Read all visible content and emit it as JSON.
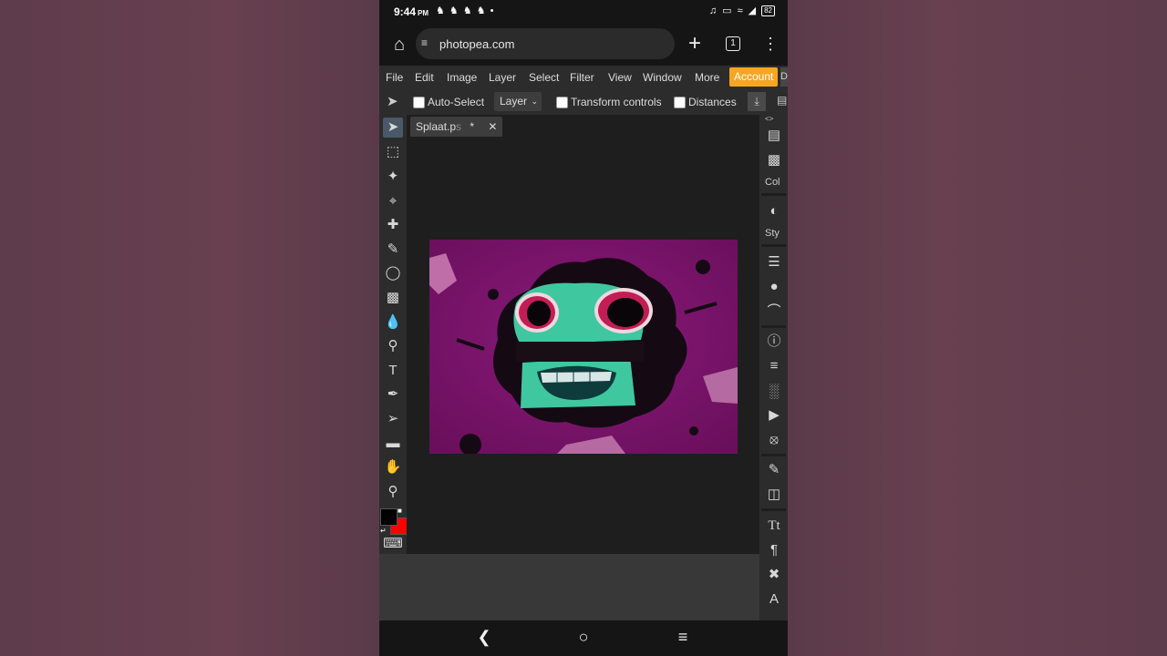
{
  "status_bar": {
    "time": "9:44",
    "ampm": "PM",
    "notifications": "♞ ♞ ♞ ♞ •",
    "battery": "82"
  },
  "browser": {
    "url": "photopea.com",
    "tab_count": "1"
  },
  "menu": {
    "items": [
      "File",
      "Edit",
      "Image",
      "Layer",
      "Select",
      "Filter",
      "View",
      "Window",
      "More"
    ],
    "account": "Account",
    "truncated": "D"
  },
  "options_bar": {
    "auto_select_label": "Auto-Select",
    "auto_select_checked": false,
    "layer_select_value": "Layer",
    "transform_controls_label": "Transform controls",
    "transform_controls_checked": false,
    "distances_label": "Distances",
    "distances_checked": false
  },
  "document": {
    "tab_title": "Splaat.p",
    "tab_ext_fade": "s",
    "modified_marker": "*",
    "close_symbol": "✕"
  },
  "right_panel": {
    "collapse_symbol": "<>",
    "color_label": "Col",
    "style_label": "Sty"
  },
  "colors": {
    "foreground": "#000000",
    "background": "#ff0000",
    "accent": "#f5a623"
  }
}
